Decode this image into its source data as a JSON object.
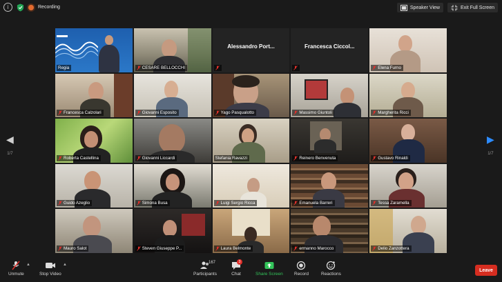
{
  "top_bar": {
    "recording_label": "Recording",
    "speaker_view_label": "Speaker View",
    "exit_full_screen_label": "Exit Full Screen"
  },
  "navigation": {
    "left_page": "1/7",
    "right_page": "1/7"
  },
  "participants": [
    {
      "name": "Regia",
      "muted": false,
      "kind": "slide"
    },
    {
      "name": "CESARE BELLOCCHI",
      "muted": true,
      "kind": "video"
    },
    {
      "name": "Alessandro  Port...",
      "muted": true,
      "kind": "name-only"
    },
    {
      "name": "Francesca  Ciccol...",
      "muted": true,
      "kind": "name-only"
    },
    {
      "name": "Elena Furno",
      "muted": true,
      "kind": "video"
    },
    {
      "name": "Francesca Calzolari",
      "muted": true,
      "kind": "video"
    },
    {
      "name": "Giovanni Esposito",
      "muted": true,
      "kind": "video"
    },
    {
      "name": "Yago Pasqualotto",
      "muted": true,
      "kind": "video"
    },
    {
      "name": "Massimo Giuntoli",
      "muted": true,
      "kind": "video"
    },
    {
      "name": "Margherita Ricci",
      "muted": true,
      "kind": "video"
    },
    {
      "name": "Roberta Castellina",
      "muted": true,
      "kind": "video"
    },
    {
      "name": "Giovanni Liccardi",
      "muted": true,
      "kind": "video"
    },
    {
      "name": "Stefania Ravazzi",
      "muted": false,
      "kind": "video",
      "active": true
    },
    {
      "name": "Reinero Benvenuta",
      "muted": true,
      "kind": "video"
    },
    {
      "name": "Gustavo Rinaldi",
      "muted": true,
      "kind": "video"
    },
    {
      "name": "Guido Azeglio",
      "muted": true,
      "kind": "video"
    },
    {
      "name": "Simona Busa",
      "muted": true,
      "kind": "video"
    },
    {
      "name": "Luigi Sergio Ricca",
      "muted": true,
      "kind": "video"
    },
    {
      "name": "Emanuela Barreri",
      "muted": true,
      "kind": "video"
    },
    {
      "name": "Tessa Zaramella",
      "muted": true,
      "kind": "video"
    },
    {
      "name": "Mauro Salot",
      "muted": true,
      "kind": "video"
    },
    {
      "name": "Steven Giuseppe P...",
      "muted": true,
      "kind": "video"
    },
    {
      "name": "Laura Belmonte",
      "muted": true,
      "kind": "video"
    },
    {
      "name": "ermanno Marocco",
      "muted": true,
      "kind": "video"
    },
    {
      "name": "Delio Zanzottera",
      "muted": true,
      "kind": "video"
    }
  ],
  "bottom_bar": {
    "unmute": "Unmute",
    "stop_video": "Stop Video",
    "participants": "Participants",
    "participants_count": "167",
    "chat": "Chat",
    "chat_badge": "3",
    "share_screen": "Share Screen",
    "record": "Record",
    "reactions": "Reactions",
    "leave": "Leave"
  },
  "colors": {
    "background": "#1a1a1a",
    "active_speaker_border": "#c8e61a",
    "share_green": "#33c45a",
    "leave_red": "#d62d20",
    "recording_orange": "#e36a2e"
  }
}
